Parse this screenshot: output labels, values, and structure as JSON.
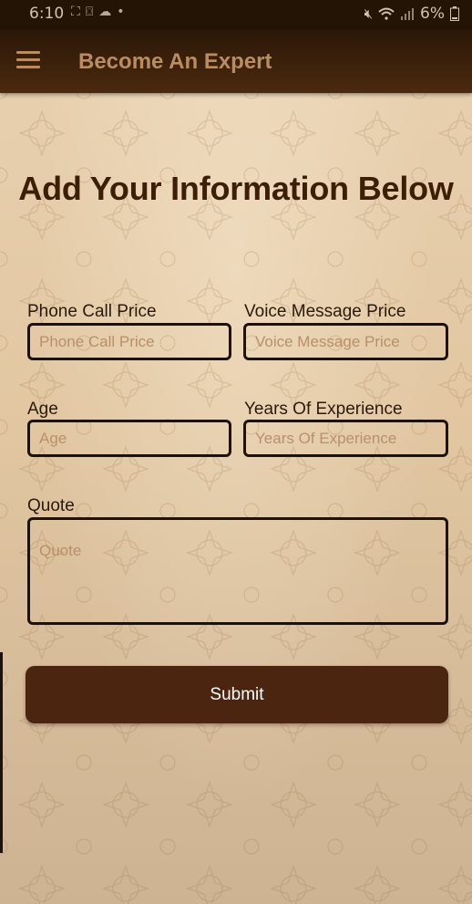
{
  "status_bar": {
    "time": "6:10",
    "battery": "6%",
    "icons_left": [
      "screenshot-icon",
      "cast-icon",
      "weather-icon",
      "dot-icon"
    ],
    "icons_right": [
      "mute-icon",
      "wifi-icon",
      "signal-icon",
      "battery-icon"
    ]
  },
  "app_bar": {
    "title": "Become An Expert",
    "menu_icon": "hamburger-menu-icon"
  },
  "form": {
    "heading": "Add Your Information Below",
    "phone_call_price": {
      "label": "Phone Call Price",
      "placeholder": "Phone Call Price",
      "value": ""
    },
    "voice_message_price": {
      "label": "Voice Message Price",
      "placeholder": "Voice Message Price",
      "value": ""
    },
    "age": {
      "label": "Age",
      "placeholder": "Age",
      "value": ""
    },
    "years_of_experience": {
      "label": "Years Of Experience",
      "placeholder": "Years Of Experience",
      "value": ""
    },
    "quote": {
      "label": "Quote",
      "placeholder": "Quote",
      "value": ""
    },
    "submit_label": "Submit"
  },
  "colors": {
    "app_bar": "#3a200b",
    "app_title": "#b98c62",
    "heading": "#3c1f06",
    "button": "#4b2510",
    "background": "#e3c9a5",
    "placeholder": "#ba8f6b"
  }
}
